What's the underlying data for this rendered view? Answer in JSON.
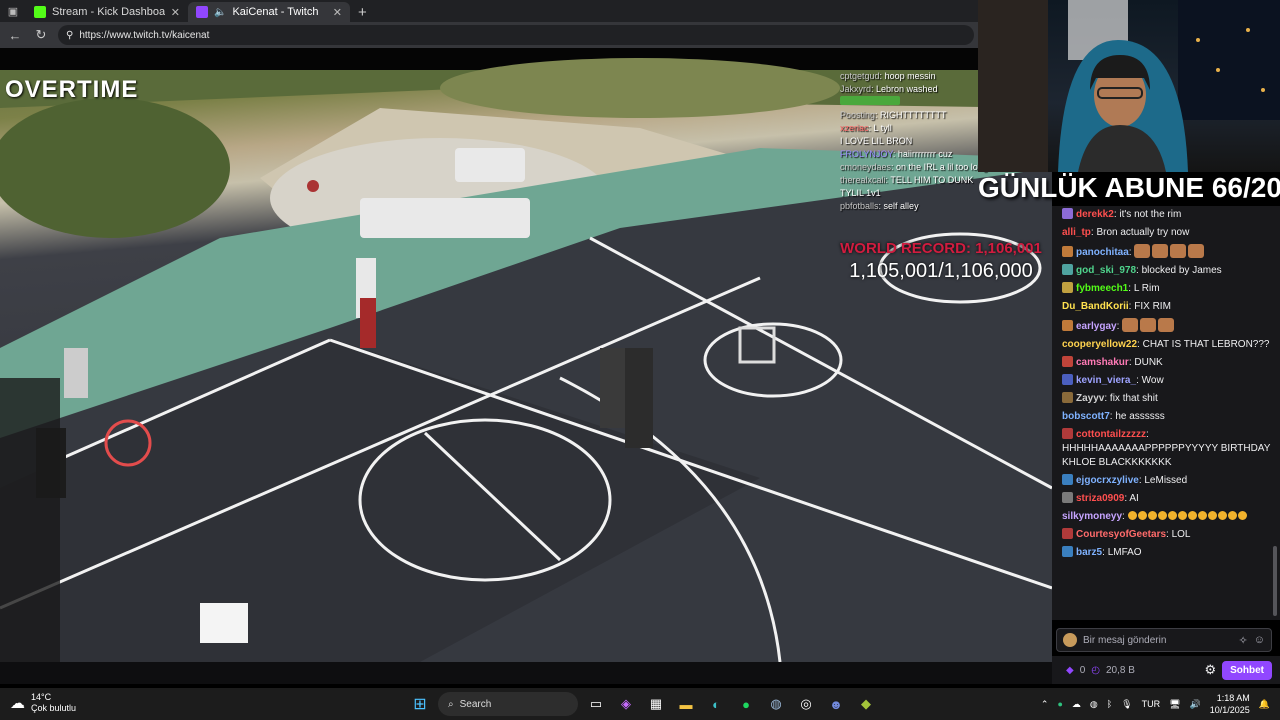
{
  "browser": {
    "tabs": [
      {
        "title": "Stream - Kick Dashboard",
        "color": "#53fc18",
        "active": false
      },
      {
        "title": "KaiCenat - Twitch",
        "color": "#9147ff",
        "active": true
      }
    ],
    "url": "https://www.twitch.tv/kaicenat"
  },
  "stream": {
    "overtime": "OVERTIME",
    "overlay_chat": [
      {
        "user": "cptgetgud",
        "text": "hoop messin",
        "color": "#c8c8c8"
      },
      {
        "user": "Jakxyrd",
        "text": "Lebron washed",
        "color": "#c8c8c8"
      },
      {
        "user": "",
        "text": "",
        "color": "#c8c8c8"
      },
      {
        "user": "Poosting",
        "text": "RIGHTTTTTTTT",
        "color": "#c8c8c8"
      },
      {
        "user": "xzeriac",
        "text": "L tyll",
        "color": "#ff6b6b"
      },
      {
        "user": "",
        "text": "I LOVE LIL BRON",
        "color": "#9c8cff"
      },
      {
        "user": "FROLYNJOY",
        "text": "haiirrrrrrrr cuz",
        "color": "#9c8cff"
      },
      {
        "user": "cmoneydaes",
        "text": "on the IRL a lil too long now",
        "color": "#c8c8c8"
      },
      {
        "user": "therealxcali",
        "text": "TELL HIM TO DUNK",
        "color": "#c8c8c8"
      },
      {
        "user": "",
        "text": "TYLIL 1v1",
        "color": "#c8c8c8"
      },
      {
        "user": "pbfotballs",
        "text": "self alley",
        "color": "#c8c8c8"
      }
    ],
    "record_title": "WORLD RECORD: 1,106,001",
    "record_count": "1,105,001/1,106,000",
    "subgoal": "GÜNLÜK ABUNE 66/20"
  },
  "chat": {
    "messages": [
      {
        "user": "derekk2",
        "text": "it's not the rim",
        "color": "#ff4f4f",
        "badge": "#8c6bd6",
        "emotes": 0,
        "emojis": 0
      },
      {
        "user": "alli_tp",
        "text": "Bron actually try now",
        "color": "#ff4f4f",
        "badge": "",
        "emotes": 0,
        "emojis": 0
      },
      {
        "user": "panochitaa",
        "text": "",
        "color": "#7fb2ff",
        "badge": "#c07a3a",
        "emotes": 4,
        "emojis": 0
      },
      {
        "user": "god_ski_978",
        "text": "blocked by James",
        "color": "#4fd38c",
        "badge": "#4fa3a0",
        "emotes": 0,
        "emojis": 0
      },
      {
        "user": "fybmeech1",
        "text": "L Rim",
        "color": "#53fc18",
        "badge": "#c0a040",
        "emotes": 0,
        "emojis": 0
      },
      {
        "user": "Du_BandKorii",
        "text": "FIX RIM",
        "color": "#ffe14f",
        "badge": "",
        "emotes": 0,
        "emojis": 0
      },
      {
        "user": "earlygay",
        "text": "",
        "color": "#c6a4ff",
        "badge": "#c07a3a",
        "emotes": 3,
        "emojis": 0
      },
      {
        "user": "cooperyellow22",
        "text": "CHAT IS THAT LEBRON???",
        "color": "#ffd34f",
        "badge": "",
        "emotes": 0,
        "emojis": 0
      },
      {
        "user": "camshakur",
        "text": "DUNK",
        "color": "#ff7ab6",
        "badge": "#c0443a",
        "emotes": 0,
        "emojis": 0
      },
      {
        "user": "kevin_viera_",
        "text": "Wow",
        "color": "#9ea3ff",
        "badge": "#4b5fbf",
        "emotes": 0,
        "emojis": 0
      },
      {
        "user": "Zayyv",
        "text": "fix that shit",
        "color": "#d0d0d0",
        "badge": "#8a6a3a",
        "emotes": 0,
        "emojis": 0
      },
      {
        "user": "bobscott7",
        "text": "he assssss",
        "color": "#7fb2ff",
        "badge": "",
        "emotes": 0,
        "emojis": 0
      },
      {
        "user": "cottontailzzzzz",
        "text": "HHHHHAAAAAAAPPPPPPYYYYY BIRTHDAY KHLOE BLACKKKKKKK",
        "color": "#ff4f4f",
        "badge": "#b03a3a",
        "emotes": 0,
        "emojis": 0
      },
      {
        "user": "ejgocrxzylive",
        "text": "LeMissed",
        "color": "#7fb2ff",
        "badge": "#3a7fbf",
        "emotes": 0,
        "emojis": 0
      },
      {
        "user": "striza0909",
        "text": "AI",
        "color": "#ff4f4f",
        "badge": "#7a7a7a",
        "emotes": 0,
        "emojis": 0
      },
      {
        "user": "silkymoneyy",
        "text": "",
        "color": "#c6a4ff",
        "badge": "",
        "emotes": 0,
        "emojis": 12
      },
      {
        "user": "CourtesyofGeetars",
        "text": "LOL",
        "color": "#ff6b6b",
        "badge": "#b03a3a",
        "emotes": 0,
        "emojis": 0
      },
      {
        "user": "barz5",
        "text": "LMFAO",
        "color": "#7fb2ff",
        "badge": "#3a7fbf",
        "emotes": 0,
        "emojis": 0
      }
    ],
    "input_placeholder": "Bir mesaj gönderin",
    "points": "0",
    "viewers": "20,8 B",
    "send_label": "Sohbet"
  },
  "taskbar": {
    "weather_temp": "14°C",
    "weather_desc": "Çok bulutlu",
    "search_label": "Search",
    "lang": "TUR",
    "time": "1:18 AM",
    "date": "10/1/2025"
  }
}
